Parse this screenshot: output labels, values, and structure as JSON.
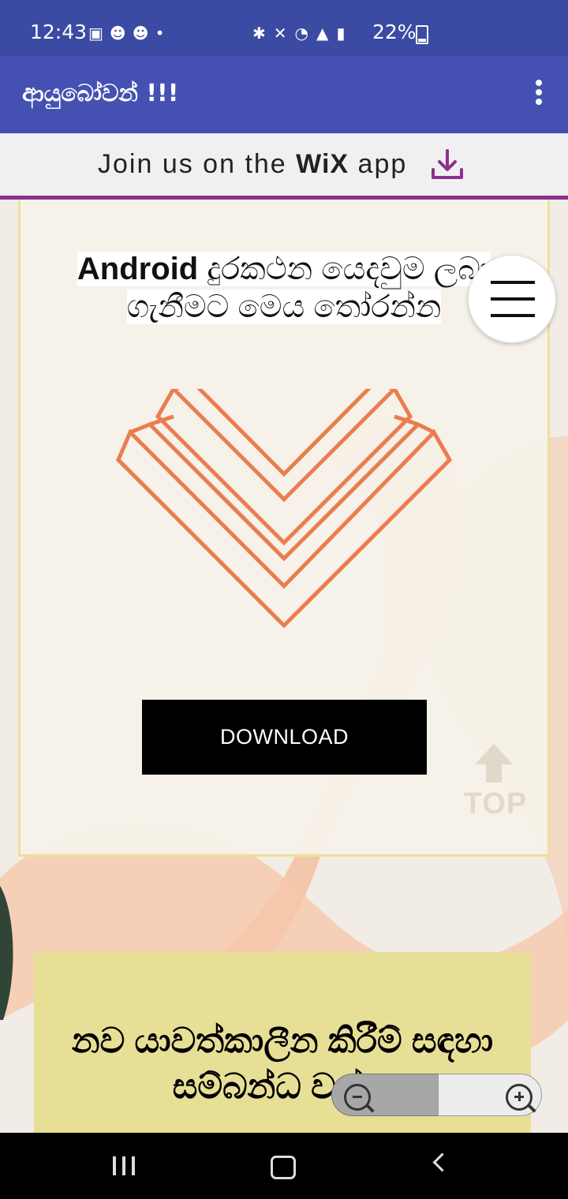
{
  "statusbar": {
    "time": "12:43",
    "battery": "22%",
    "icons": {
      "left": [
        "gallery-icon",
        "snapchat-icon",
        "snapchat-icon",
        "dot-icon"
      ],
      "right": [
        "bluetooth-icon",
        "mute-icon",
        "hotspot-icon",
        "4g-icon",
        "signal-icon",
        "battery-icon"
      ]
    }
  },
  "appbar": {
    "title": "ආයුබෝවන් !!!",
    "menu_icon": "more-vert-icon"
  },
  "wix_banner": {
    "prefix": "Join us on the ",
    "logo": "WiX",
    "suffix": "app",
    "download_icon": "download-icon"
  },
  "main": {
    "headline_bold": "Android",
    "headline_rest": " දුරකථන යෙදවුම ලබා ගැනීමට මෙය තෝරන්න",
    "download_button": "DOWNLOAD",
    "top_button": "TOP",
    "section_title": "නව යාවත්කාලීන කිරීම් සඳහා සම්බන්ධ වන්න"
  },
  "colors": {
    "status_bar": "#3b4aa3",
    "app_bar": "#4451b3",
    "accent_purple": "#8e2f8f",
    "orange_logo": "#ea7d4f",
    "yellow_section": "#e8df97"
  }
}
